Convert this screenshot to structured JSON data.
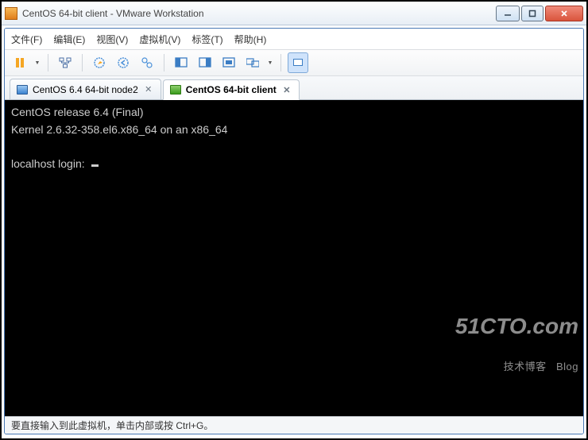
{
  "window": {
    "title": "CentOS 64-bit client - VMware Workstation"
  },
  "menu": {
    "file": "文件(F)",
    "edit": "编辑(E)",
    "view": "视图(V)",
    "vm": "虚拟机(V)",
    "tabs": "标签(T)",
    "help": "帮助(H)"
  },
  "tabs": {
    "inactive": {
      "label": "CentOS 6.4 64-bit node2"
    },
    "active": {
      "label": "CentOS 64-bit client"
    }
  },
  "console": {
    "line1": "CentOS release 6.4 (Final)",
    "line2": "Kernel 2.6.32-358.el6.x86_64 on an x86_64",
    "blank": "",
    "prompt": "localhost login: "
  },
  "status": {
    "text": "要直接输入到此虚拟机，单击内部或按 Ctrl+G。"
  },
  "watermark": {
    "big": "51CTO.com",
    "small": "技术博客   Blog"
  }
}
